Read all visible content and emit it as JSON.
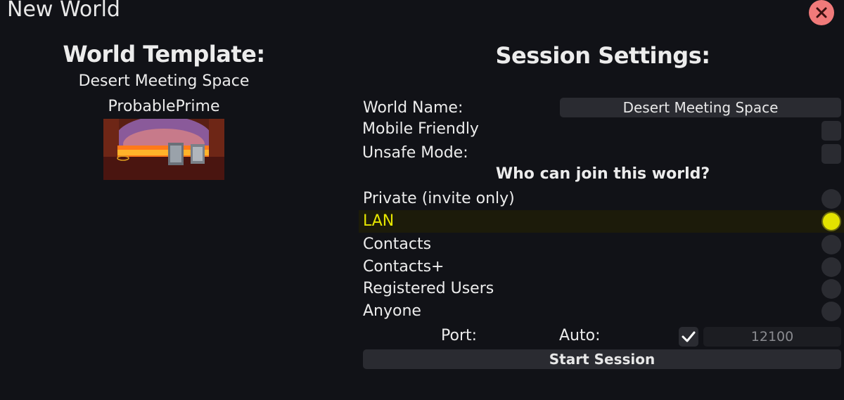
{
  "window": {
    "title": "New World",
    "close_icon": "close-icon",
    "close_color": "#f07a7a"
  },
  "template": {
    "heading": "World Template:",
    "name": "Desert Meeting Space",
    "author": "ProbablePrime"
  },
  "session": {
    "heading": "Session Settings:",
    "world_name_label": "World Name:",
    "world_name_value": "Desert Meeting Space",
    "mobile_friendly_label": "Mobile Friendly",
    "unsafe_mode_label": "Unsafe Mode:",
    "access_question": "Who can join this world?",
    "access_options": [
      {
        "label": "Private (invite only)",
        "selected": false
      },
      {
        "label": "LAN",
        "selected": true
      },
      {
        "label": "Contacts",
        "selected": false
      },
      {
        "label": "Contacts+",
        "selected": false
      },
      {
        "label": "Registered Users",
        "selected": false
      },
      {
        "label": "Anyone",
        "selected": false
      }
    ],
    "port_label": "Port:",
    "auto_label": "Auto:",
    "auto_checked": true,
    "port_value": "12100",
    "start_button": "Start Session"
  },
  "colors": {
    "background": "#111217",
    "selected": "#e3e300",
    "control": "#2a2b31"
  }
}
